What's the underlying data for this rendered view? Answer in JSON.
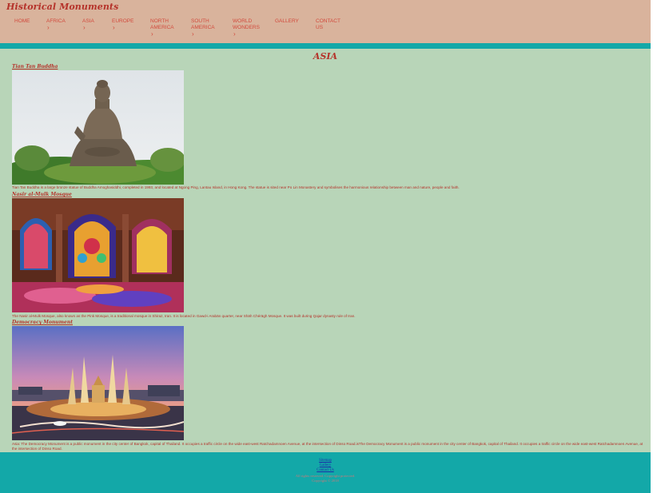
{
  "header": {
    "site_title": "Historical Monuments",
    "nav": [
      {
        "line1": "HOME",
        "line2": "",
        "chevron": ""
      },
      {
        "line1": "AFRICA",
        "line2": "",
        "chevron": "›"
      },
      {
        "line1": "ASIA",
        "line2": "",
        "chevron": "›"
      },
      {
        "line1": "EUROPE",
        "line2": "",
        "chevron": "›"
      },
      {
        "line1": "NORTH",
        "line2": "AMERICA",
        "chevron": "›"
      },
      {
        "line1": "SOUTH",
        "line2": "AMERICA",
        "chevron": "›"
      },
      {
        "line1": "WORLD",
        "line2": "WONDERS",
        "chevron": "›"
      },
      {
        "line1": "GALLERY",
        "line2": "",
        "chevron": ""
      },
      {
        "line1": "CONTACT",
        "line2": "US",
        "chevron": ""
      }
    ]
  },
  "page": {
    "heading": "ASIA"
  },
  "monuments": [
    {
      "title": "Tian Tan Buddha",
      "image": "bronze-buddha-statue-photo",
      "description": "Tian Tan Buddha is a large bronze statue of Buddha Amoghasiddhi, completed in 1993, and located at Ngong Ping, Lantau Island, in Hong Kong. The statue is sited near Po Lin Monastery and symbolises the harmonious relationship between man and nature, people and faith."
    },
    {
      "title": "Nasir al-Mulk Mosque",
      "image": "stained-glass-mosque-interior-photo",
      "description": "The Nasir al-Mulk Mosque, also known as the Pink Mosque, is a traditional mosque in Shiraz, Iran. It is located in Gawd-i Arabān quarter, near Shāh Chérāgh Mosque. It was built during Qajar dynasty rule of Iran."
    },
    {
      "title": "Democracy Monument",
      "image": "democracy-monument-dusk-photo",
      "description": "Asia: The Democracy Monument is a public monument in the city center of Bangkok, capital of Thailand. It occupies a traffic circle on the wide east-west Ratchadamnoen Avenue, at the intersection of Dinso Road.isThe Democracy Monument is a public monument in the city center of Bangkok, capital of Thailand. It occupies a traffic circle on the wide east-west Ratchadamnoen Avenue, at the intersection of Dinso Road."
    }
  ],
  "footer": {
    "links": [
      "Sitemap",
      "Gallery",
      "Contact Us"
    ],
    "rights": "All rights reserved. Copyright protected.",
    "copyright": "Copyright © 2018"
  },
  "colors": {
    "header_bg": "#d9b39c",
    "teal": "#13a8a8",
    "page_bg": "#b8d5b8",
    "accent_red": "#b5322a"
  }
}
